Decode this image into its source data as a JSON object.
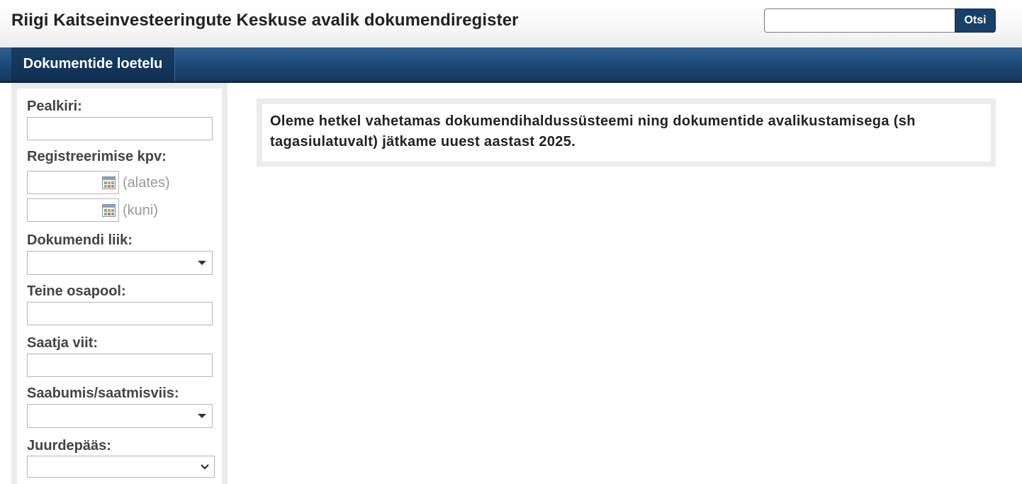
{
  "header": {
    "title": "Riigi Kaitseinvesteeringute Keskuse avalik dokumendiregister",
    "search_placeholder": "",
    "search_button": "Otsi"
  },
  "nav": {
    "active_tab": "Dokumentide loetelu"
  },
  "filters": {
    "title_label": "Pealkiri:",
    "reg_date_label": "Registreerimise kpv:",
    "from_hint": "(alates)",
    "to_hint": "(kuni)",
    "doc_type_label": "Dokumendi liik:",
    "doc_type_value": "",
    "party_label": "Teine osapool:",
    "sender_ref_label": "Saatja viit:",
    "delivery_label": "Saabumis/saatmisviis:",
    "delivery_value": "",
    "access_label": "Juurdepääs:",
    "access_value": ""
  },
  "notice": {
    "text": "Oleme hetkel vahetamas dokumendihaldussüsteemi ning dokumentide avalikustamisega (sh tagasiulatuvalt) jätkame uuest aastast 2025."
  },
  "icons": {
    "calendar": "calendar-icon",
    "dropdown": "dropdown-caret-icon",
    "chevron": "chevron-down-icon"
  },
  "colors": {
    "nav_blue": "#1f4a78",
    "button_blue": "#173f6a",
    "label_gray": "#444444"
  }
}
